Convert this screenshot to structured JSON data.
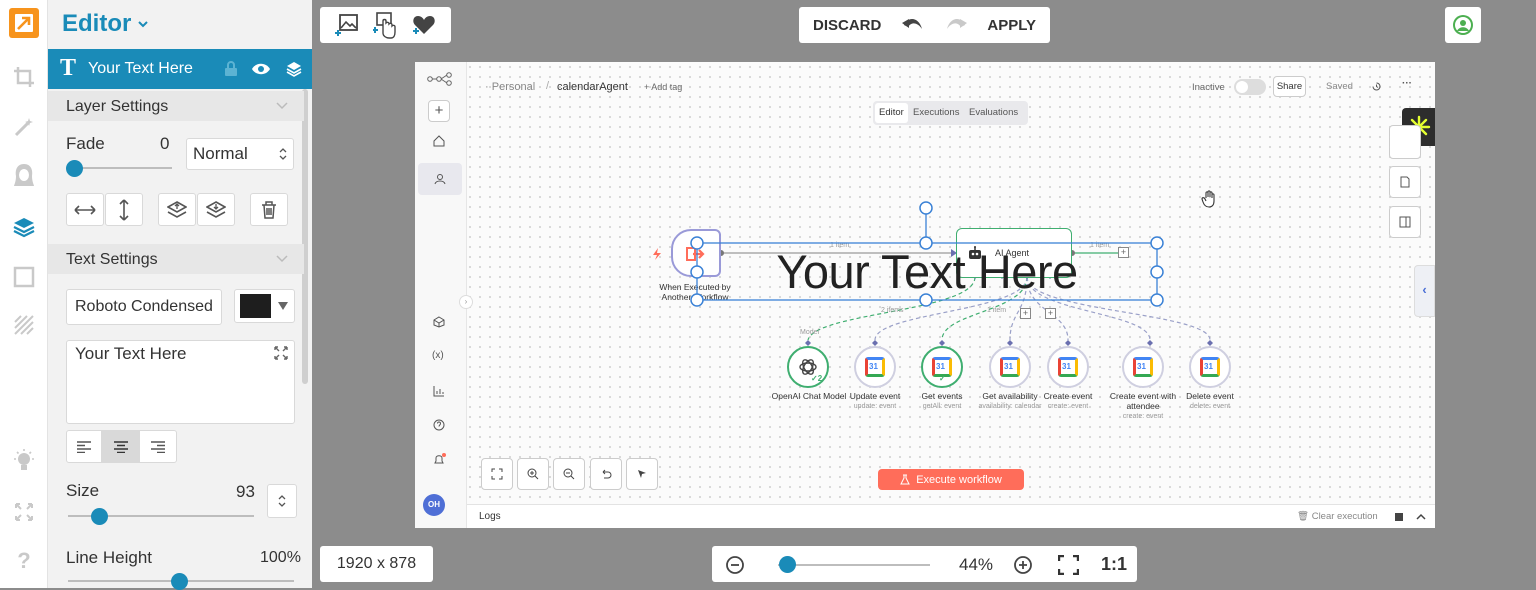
{
  "app": {
    "editor_title": "Editor"
  },
  "layer": {
    "name": "Your Text Here"
  },
  "layer_settings": {
    "title": "Layer Settings",
    "fade_label": "Fade",
    "fade_value": "0",
    "blend_mode": "Normal",
    "fade_level": 0
  },
  "text_settings": {
    "title": "Text Settings",
    "font": "Roboto Condensed",
    "color": "#1e1e1e",
    "text_value": "Your Text Here",
    "size_label": "Size",
    "size_value": "93",
    "line_height_label": "Line Height",
    "line_height_value": "100%",
    "align": "center"
  },
  "toolbar": {
    "discard": "DISCARD",
    "apply": "APPLY"
  },
  "canvas_info": {
    "dimensions": "1920 x 878",
    "zoom": "44%",
    "one_to_one": "1:1",
    "zoom_level": 0.44
  },
  "overlay_text": "Your Text Here",
  "n8n": {
    "breadcrumb_personal": "Personal",
    "breadcrumb_sep": "/",
    "workflow_name": "calendarAgent",
    "add_tag": "+ Add tag",
    "status": "Inactive",
    "share": "Share",
    "saved": "Saved",
    "more": "···",
    "tabs": [
      "Editor",
      "Executions",
      "Evaluations"
    ],
    "trigger_label": "When Executed by Another Workflow",
    "agent_label": "AI Agent",
    "edge_items_1": "1 item",
    "edge_items_2": "1 item",
    "edge_items_3": "2 items",
    "edge_items_4": "1 item",
    "model_tag": "Model",
    "tools": [
      {
        "label": "OpenAI Chat Model",
        "sub": ""
      },
      {
        "label": "Update event",
        "sub": "update: event"
      },
      {
        "label": "Get events",
        "sub": "getAll: event"
      },
      {
        "label": "Get availability",
        "sub": "availability: calendar"
      },
      {
        "label": "Create event",
        "sub": "create: event"
      },
      {
        "label": "Create event with attendee",
        "sub": "create: event"
      },
      {
        "label": "Delete event",
        "sub": "delete: event"
      }
    ],
    "execute": "Execute workflow",
    "logs": "Logs",
    "clear_execution": "Clear execution",
    "avatar": "OH"
  },
  "colors": {
    "accent": "#1a8bb8",
    "n8n_orange": "#ff6d5a",
    "dark_text": "#222222"
  }
}
